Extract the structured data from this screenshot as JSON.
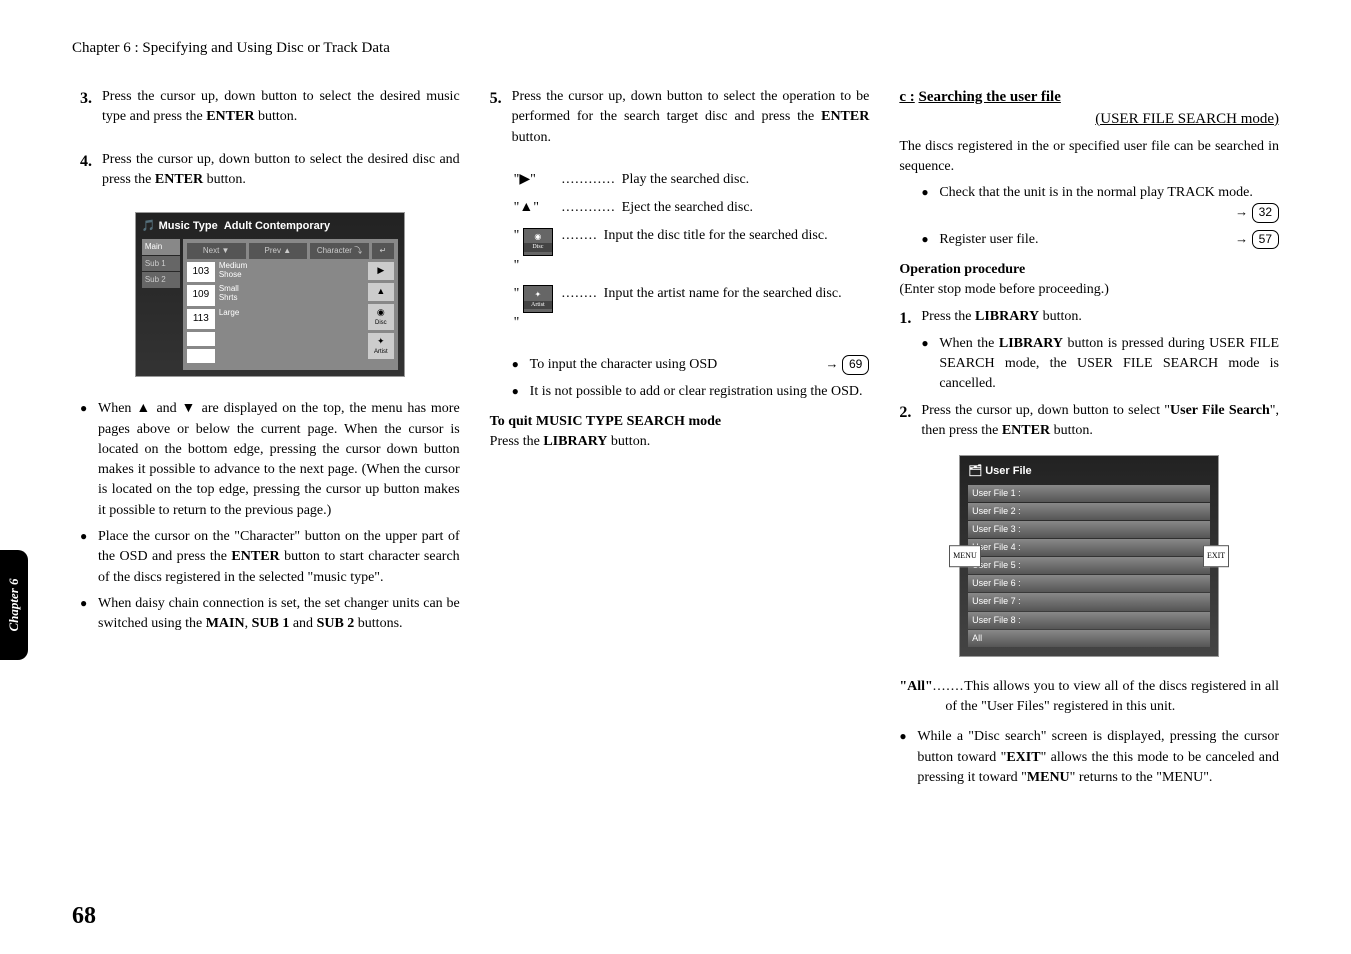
{
  "header": "Chapter 6 : Specifying and Using Disc or Track Data",
  "sidetab": "Chapter 6",
  "pagenum": "68",
  "col1": {
    "step3": {
      "num": "3.",
      "text_a": "Press the cursor up, down button to select the desired music type and press the ",
      "enter": "ENTER",
      "text_b": " button."
    },
    "step4": {
      "num": "4.",
      "text_a": "Press the cursor up, down button to select the desired disc and press the ",
      "enter": "ENTER",
      "text_b": " button."
    },
    "osd": {
      "title_a": "Music Type",
      "title_b": "Adult Contemporary",
      "tabs": [
        "Main",
        "Sub 1",
        "Sub 2"
      ],
      "top": [
        "Next ▼",
        "Prev ▲",
        "Character ⤵",
        "↵"
      ],
      "rows": [
        {
          "n": "103",
          "t1": "Medium",
          "t2": "Shose"
        },
        {
          "n": "109",
          "t1": "Small",
          "t2": "Shrts"
        },
        {
          "n": "113",
          "t1": "Large",
          "t2": ""
        }
      ],
      "side": [
        "▶",
        "▲",
        "◉",
        "Disc",
        "✦",
        "Artist"
      ]
    },
    "b1": "When ▲ and ▼ are displayed on the top, the menu has more pages above or below the current page. When the cursor is located on the bottom edge, pressing the cursor down button makes it possible to advance to the next page. (When the cursor is located on the top edge, pressing the cursor up button makes it possible to return to the previous page.)",
    "b2_a": "Place the cursor on the \"Character\" button on the upper part of the OSD and press the ",
    "b2_enter": "ENTER",
    "b2_b": " button to start character search of the discs registered in the selected \"music type\".",
    "b3_a": "When daisy chain connection is set, the set changer units can be switched using the ",
    "b3_main": "MAIN",
    "b3_c": ", ",
    "b3_sub1": "SUB 1",
    "b3_and": " and ",
    "b3_sub2": "SUB 2",
    "b3_b": " buttons."
  },
  "col2": {
    "step5": {
      "num": "5.",
      "text_a": "Press the cursor up, down button to select the operation to be performed for the search target disc and press the ",
      "enter": "ENTER",
      "text_b": " button."
    },
    "s1": {
      "sym": "\"▶\"",
      "dots": "............",
      "txt": "Play the searched disc."
    },
    "s2": {
      "sym": "\"▲\"",
      "dots": "............",
      "txt": "Eject the searched disc."
    },
    "s3": {
      "icon_top": "◉",
      "icon_sub": "Disc",
      "dots": "........",
      "txt": "Input the disc title for the searched disc."
    },
    "s4": {
      "icon_top": "✦",
      "icon_sub": "Artist",
      "dots": "........",
      "txt": "Input the artist name for the searched disc."
    },
    "b1": {
      "txt": "To input the character using OSD",
      "ref": "69"
    },
    "b2": "It is not possible to add or clear registration using the OSD.",
    "quit_head": "To quit MUSIC TYPE SEARCH mode",
    "quit_a": "Press the ",
    "quit_lib": "LIBRARY",
    "quit_b": " button."
  },
  "col3": {
    "head_a": "c :",
    "head_b": "Searching the user file",
    "head_c": "(USER FILE SEARCH mode)",
    "intro": "The discs registered in the or specified user file can be searched in sequence.",
    "b1": {
      "txt": "Check that the unit is in the normal play TRACK mode.",
      "ref": "32"
    },
    "b2": {
      "txt": "Register user file.",
      "ref": "57"
    },
    "op_head": "Operation procedure",
    "op_intro": "(Enter stop mode before proceeding.)",
    "step1": {
      "num": "1.",
      "a": "Press the ",
      "lib": "LIBRARY",
      "b": " button."
    },
    "step1_b": {
      "a": "When the ",
      "lib": "LIBRARY",
      "b": " button is pressed during USER FILE SEARCH mode, the USER FILE SEARCH mode is cancelled."
    },
    "step2": {
      "num": "2.",
      "a": "Press the cursor up, down button to select \"",
      "ufs": "User File Search",
      "b": "\", then press the ",
      "enter": "ENTER",
      "c": " button."
    },
    "osd": {
      "title": "User File",
      "items": [
        "User File 1 :",
        "User File 2 :",
        "User File 3 :",
        "User File 4 :",
        "User File 5 :",
        "User File 6 :",
        "User File 7 :",
        "User File 8 :",
        "All"
      ],
      "menu": "MENU",
      "exit": "EXIT"
    },
    "all": {
      "label": "\"All\"",
      "dots": ".......",
      "txt": "This allows you to view all of the discs registered in all of the \"User Files\" registered in this unit."
    },
    "last": {
      "a": "While a \"Disc search\" screen is displayed, pressing the cursor button toward \"",
      "exit": "EXIT",
      "b": "\" allows the this mode to be canceled and pressing it toward \"",
      "menu": "MENU",
      "c": "\" returns to the \"MENU\"."
    }
  }
}
